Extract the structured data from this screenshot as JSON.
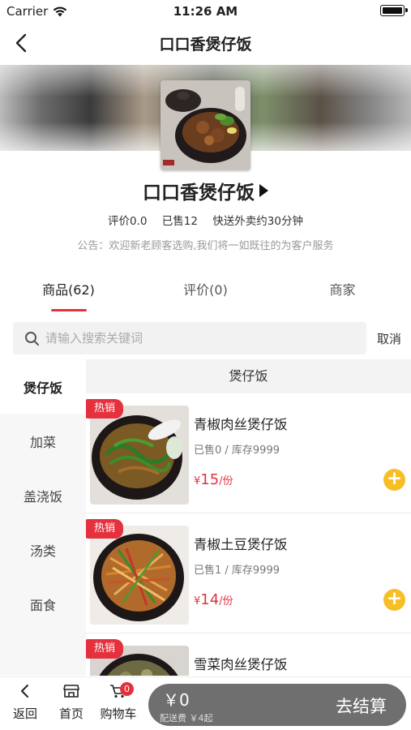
{
  "status_bar": {
    "carrier": "Carrier",
    "time": "11:26 AM"
  },
  "nav": {
    "title": "口口香煲仔饭"
  },
  "shop": {
    "name": "口口香煲仔饭",
    "rating": "评价0.0",
    "sold": "已售12",
    "delivery": "快送外卖约30分钟",
    "notice": "公告：欢迎新老顾客选购,我们将一如既往的为客户服务"
  },
  "tabs": [
    {
      "label": "商品(62)"
    },
    {
      "label": "评价(0)"
    },
    {
      "label": "商家"
    }
  ],
  "search": {
    "placeholder": "请输入搜索关键词",
    "cancel": "取消"
  },
  "categories": [
    {
      "label": "煲仔饭"
    },
    {
      "label": "加菜"
    },
    {
      "label": "盖浇饭"
    },
    {
      "label": "汤类"
    },
    {
      "label": "面食"
    }
  ],
  "content": {
    "section_title": "煲仔饭",
    "products": [
      {
        "badge": "热销",
        "name": "青椒肉丝煲仔饭",
        "stats": "已售0 / 库存9999",
        "currency": "¥",
        "price": "15",
        "unit": "/份"
      },
      {
        "badge": "热销",
        "name": "青椒土豆煲仔饭",
        "stats": "已售1 / 库存9999",
        "currency": "¥",
        "price": "14",
        "unit": "/份"
      },
      {
        "badge": "热销",
        "name": "雪菜肉丝煲仔饭",
        "stats": "",
        "currency": "",
        "price": "",
        "unit": ""
      }
    ]
  },
  "bottom_bar": {
    "back": "返回",
    "home": "首页",
    "cart": "购物车",
    "cart_count": "0",
    "total": "￥0",
    "delivery_fee": "配送费 ￥4起",
    "checkout": "去结算"
  },
  "colors": {
    "accent": "#e5303e",
    "add_button": "#f7be26",
    "checkout_bg": "#6f6f6f"
  }
}
